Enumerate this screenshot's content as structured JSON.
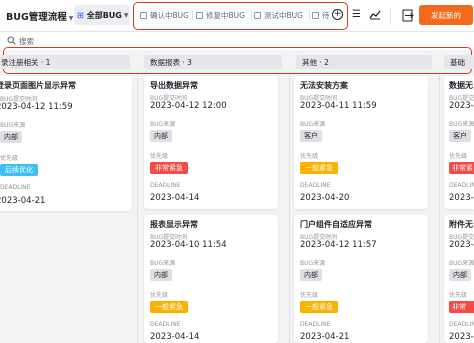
{
  "topbar": {
    "title": "BUG管理流程",
    "view_label": "全部BUG",
    "tabs": [
      "确认中BUG",
      "修复中BUG",
      "测试中BUG",
      "待"
    ],
    "new_button": "发起新的"
  },
  "search": {
    "placeholder": "搜索"
  },
  "columns": [
    {
      "name": "录注册相关 · 1"
    },
    {
      "name": "数据报表 · 3"
    },
    {
      "name": "其他 · 2"
    },
    {
      "name": "基础"
    }
  ],
  "labels": {
    "submit_time": "BUG提交时间",
    "source": "BUG来源",
    "priority": "优先级",
    "deadline": "DEADLINE"
  },
  "cards": [
    {
      "title": "登录页面图片显示异常",
      "submit_time": "2023-04-12 11:59",
      "source": "内部",
      "priority": "后续优化",
      "deadline": "2023-04-21"
    },
    {
      "title": "导出数据异常",
      "submit_time": "2023-04-12 12:00",
      "source": "内部",
      "priority": "非常紧急",
      "deadline": "2023-04-14"
    },
    {
      "title": "报表显示异常",
      "submit_time": "2023-04-10 11:54",
      "source": "内部",
      "priority": "一般紧急",
      "deadline": "2023-04-14"
    },
    {
      "title": "无法安装方案",
      "submit_time": "2023-04-11 11:59",
      "source": "客户",
      "priority": "一般紧急",
      "deadline": "2023-04-20"
    },
    {
      "title": "门户组件自适应异常",
      "submit_time": "2023-04-12 11:57",
      "source": "内部",
      "priority": "一般紧急",
      "deadline": "2023-04-21"
    },
    {
      "title": "数据无",
      "submit_time": "2023-0",
      "source": "客户",
      "priority": "非常紧",
      "deadline": "2023-0"
    },
    {
      "title": "附件无",
      "submit_time": "2023-0",
      "source": "内部",
      "priority": "非常",
      "deadline": "2023-0"
    }
  ],
  "colors": {
    "accent": "#f26b1d",
    "highlight": "#e1361b",
    "urgent": "#f54a45",
    "normal": "#fbb200",
    "later": "#3ebef5"
  }
}
